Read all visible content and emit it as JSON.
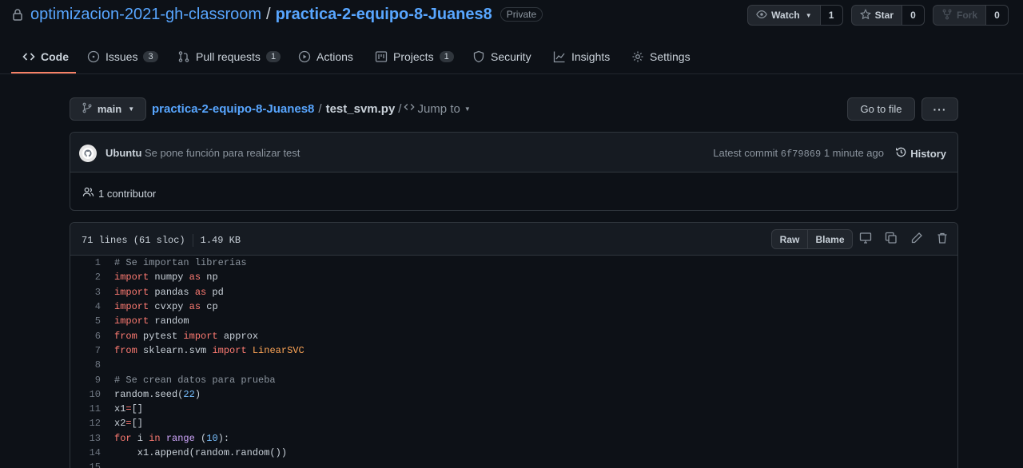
{
  "repo": {
    "owner": "optimizacion-2021-gh-classroom",
    "separator": "/",
    "name": "practica-2-equipo-8-Juanes8",
    "visibility": "Private"
  },
  "actions": {
    "watch_label": "Watch",
    "watch_count": "1",
    "star_label": "Star",
    "star_count": "0",
    "fork_label": "Fork",
    "fork_count": "0"
  },
  "tabs": [
    {
      "label": "Code",
      "icon": "code-icon"
    },
    {
      "label": "Issues",
      "count": "3",
      "icon": "issue-icon"
    },
    {
      "label": "Pull requests",
      "count": "1",
      "icon": "pull-request-icon"
    },
    {
      "label": "Actions",
      "icon": "play-icon"
    },
    {
      "label": "Projects",
      "count": "1",
      "icon": "project-icon"
    },
    {
      "label": "Security",
      "icon": "shield-icon"
    },
    {
      "label": "Insights",
      "icon": "graph-icon"
    },
    {
      "label": "Settings",
      "icon": "gear-icon"
    }
  ],
  "file_nav": {
    "branch": "main",
    "repo_link": "practica-2-equipo-8-Juanes8",
    "separator": "/",
    "file_name": "test_svm.py",
    "jump_sep": "/",
    "jump_label": "Jump to",
    "go_to_file": "Go to file",
    "more": "···"
  },
  "commit": {
    "author": "Ubuntu",
    "message": "Se pone función para realizar test",
    "latest_prefix": "Latest commit",
    "sha": "6f79869",
    "time": "1 minute ago",
    "history_label": "History",
    "contributors": "1 contributor"
  },
  "file": {
    "lines_info": "71 lines (61 sloc)",
    "size": "1.49 KB",
    "raw_label": "Raw",
    "blame_label": "Blame"
  },
  "code_lines": [
    {
      "n": "1",
      "tokens": [
        [
          "cm",
          "# Se importan librerias"
        ]
      ]
    },
    {
      "n": "2",
      "tokens": [
        [
          "kw",
          "import"
        ],
        [
          "",
          " numpy "
        ],
        [
          "kw",
          "as"
        ],
        [
          "",
          " np"
        ]
      ]
    },
    {
      "n": "3",
      "tokens": [
        [
          "kw",
          "import"
        ],
        [
          "",
          " pandas "
        ],
        [
          "kw",
          "as"
        ],
        [
          "",
          " pd"
        ]
      ]
    },
    {
      "n": "4",
      "tokens": [
        [
          "kw",
          "import"
        ],
        [
          "",
          " cvxpy "
        ],
        [
          "kw",
          "as"
        ],
        [
          "",
          " cp"
        ]
      ]
    },
    {
      "n": "5",
      "tokens": [
        [
          "kw",
          "import"
        ],
        [
          "",
          " random"
        ]
      ]
    },
    {
      "n": "6",
      "tokens": [
        [
          "kw",
          "from"
        ],
        [
          "",
          " pytest "
        ],
        [
          "kw",
          "import"
        ],
        [
          "",
          " approx"
        ]
      ]
    },
    {
      "n": "7",
      "tokens": [
        [
          "kw",
          "from"
        ],
        [
          "",
          " sklearn.svm "
        ],
        [
          "kw",
          "import"
        ],
        [
          "",
          " "
        ],
        [
          "cls",
          "LinearSVC"
        ]
      ]
    },
    {
      "n": "8",
      "tokens": []
    },
    {
      "n": "9",
      "tokens": [
        [
          "cm",
          "# Se crean datos para prueba"
        ]
      ]
    },
    {
      "n": "10",
      "tokens": [
        [
          "",
          "random.seed("
        ],
        [
          "num",
          "22"
        ],
        [
          "",
          ")"
        ]
      ]
    },
    {
      "n": "11",
      "tokens": [
        [
          "",
          "x1"
        ],
        [
          "kw",
          "="
        ],
        [
          "",
          "[]"
        ]
      ]
    },
    {
      "n": "12",
      "tokens": [
        [
          "",
          "x2"
        ],
        [
          "kw",
          "="
        ],
        [
          "",
          "[]"
        ]
      ]
    },
    {
      "n": "13",
      "tokens": [
        [
          "kw",
          "for"
        ],
        [
          "",
          " i "
        ],
        [
          "kw",
          "in"
        ],
        [
          "",
          " "
        ],
        [
          "fn",
          "range"
        ],
        [
          "",
          " ("
        ],
        [
          "num",
          "10"
        ],
        [
          "",
          "):"
        ]
      ]
    },
    {
      "n": "14",
      "tokens": [
        [
          "",
          "    x1.append(random.random())"
        ]
      ]
    },
    {
      "n": "15",
      "tokens": []
    }
  ],
  "colors": {
    "background": "#0d1117",
    "link": "#58a6ff",
    "keyword": "#ff7b72",
    "comment": "#8b949e",
    "tab_underline": "#f78166"
  }
}
